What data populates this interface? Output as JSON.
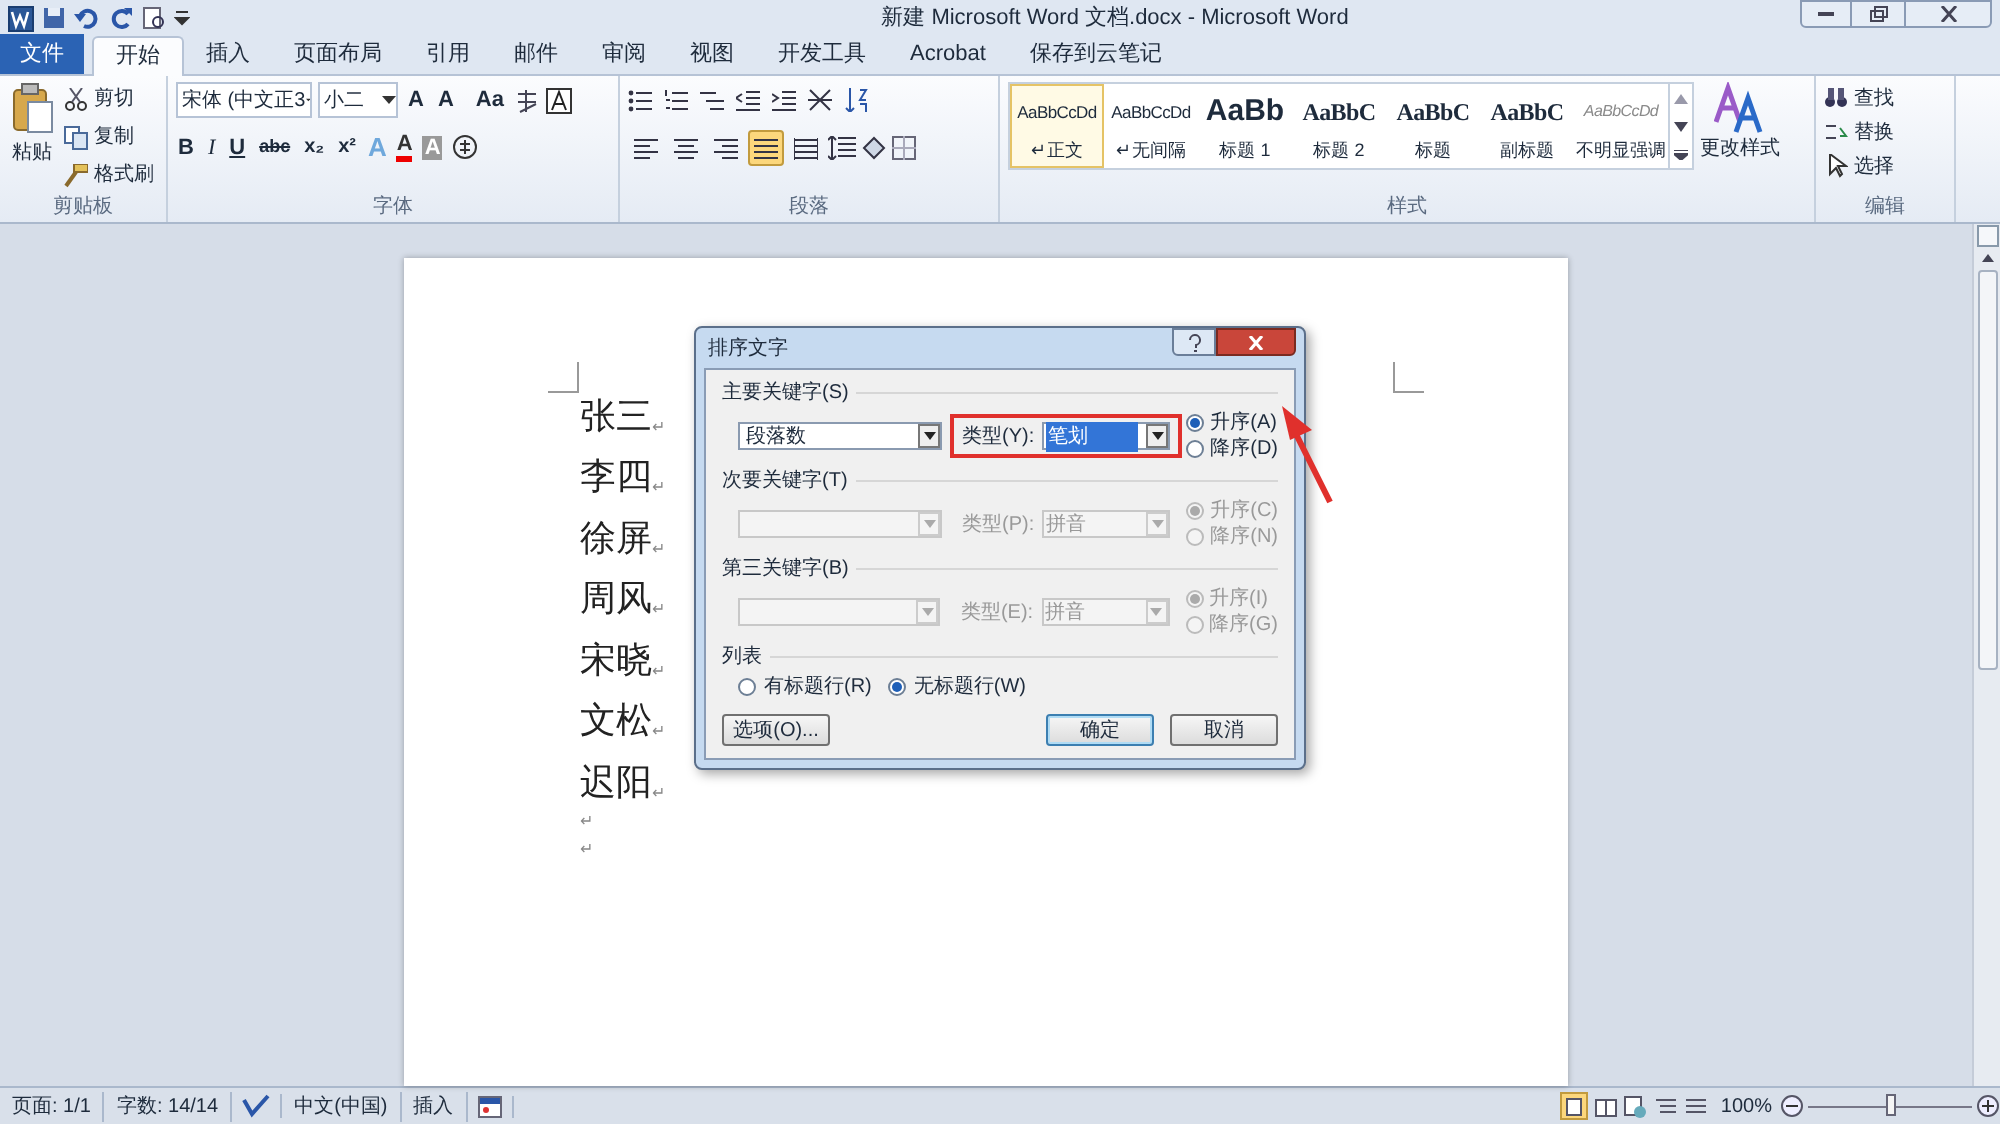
{
  "window": {
    "title": "新建 Microsoft Word 文档.docx - Microsoft Word"
  },
  "tabs": [
    {
      "label": "文件",
      "kind": "file",
      "selected": false
    },
    {
      "label": "开始",
      "kind": "tab",
      "selected": true
    },
    {
      "label": "插入",
      "kind": "tab",
      "selected": false
    },
    {
      "label": "页面布局",
      "kind": "tab",
      "selected": false
    },
    {
      "label": "引用",
      "kind": "tab",
      "selected": false
    },
    {
      "label": "邮件",
      "kind": "tab",
      "selected": false
    },
    {
      "label": "审阅",
      "kind": "tab",
      "selected": false
    },
    {
      "label": "视图",
      "kind": "tab",
      "selected": false
    },
    {
      "label": "开发工具",
      "kind": "tab",
      "selected": false
    },
    {
      "label": "Acrobat",
      "kind": "tab",
      "selected": false
    },
    {
      "label": "保存到云笔记",
      "kind": "tab",
      "selected": false
    }
  ],
  "clipboard": {
    "paste": "粘贴",
    "commands": [
      "剪切",
      "复制",
      "格式刷"
    ],
    "label": "剪贴板"
  },
  "font": {
    "name": "宋体 (中文正3",
    "size": "小二",
    "grow": "A",
    "shrink": "A",
    "case": "Aa",
    "formats": [
      "B",
      "I",
      "U",
      "abc",
      "x₂",
      "x²"
    ],
    "effects": [
      "A",
      "A",
      "A"
    ],
    "label": "字体"
  },
  "paragraph": {
    "alignments": [
      {
        "kind": "left",
        "selected": false
      },
      {
        "kind": "center",
        "selected": false
      },
      {
        "kind": "right",
        "selected": false
      },
      {
        "kind": "justify",
        "selected": true
      },
      {
        "kind": "distributed",
        "selected": false
      }
    ],
    "label": "段落"
  },
  "styles": {
    "items": [
      {
        "sample": "AaBbCcDd",
        "name": "↵正文",
        "kind": "body",
        "selected": true
      },
      {
        "sample": "AaBbCcDd",
        "name": "↵无间隔",
        "kind": "body",
        "selected": false
      },
      {
        "sample": "AaBb",
        "name": "标题 1",
        "kind": "title",
        "selected": false
      },
      {
        "sample": "AaBbC",
        "name": "标题 2",
        "kind": "heading",
        "selected": false
      },
      {
        "sample": "AaBbC",
        "name": "标题",
        "kind": "heading",
        "selected": false
      },
      {
        "sample": "AaBbC",
        "name": "副标题",
        "kind": "heading",
        "selected": false
      },
      {
        "sample": "AaBbCcDd",
        "name": "不明显强调",
        "kind": "subtle",
        "selected": false
      }
    ],
    "change": "更改样式",
    "label": "样式"
  },
  "editing": {
    "commands": [
      "查找",
      "替换",
      "选择"
    ],
    "label": "编辑"
  },
  "document": {
    "lines": [
      {
        "text": "张三",
        "mark": "↵"
      },
      {
        "text": "李四",
        "mark": "↵"
      },
      {
        "text": "徐屏",
        "mark": "↵"
      },
      {
        "text": "周风",
        "mark": "↵"
      },
      {
        "text": "宋晓",
        "mark": "↵"
      },
      {
        "text": "文松",
        "mark": "↵"
      },
      {
        "text": "迟阳",
        "mark": "↵"
      },
      {
        "mark": "↵"
      },
      {
        "mark": "↵"
      }
    ]
  },
  "dialog": {
    "title": "排序文字",
    "keys": [
      {
        "label": "主要关键字(S)",
        "field": "段落数",
        "type_label": "类型(Y):",
        "type_value": "笔划",
        "disabled": false,
        "highlighted": true,
        "order": [
          {
            "label": "升序(A)",
            "selected": true
          },
          {
            "label": "降序(D)",
            "selected": false
          }
        ]
      },
      {
        "label": "次要关键字(T)",
        "type_label": "类型(P):",
        "type_value": "拼音",
        "disabled": true,
        "highlighted": false,
        "order": [
          {
            "label": "升序(C)",
            "selected": true
          },
          {
            "label": "降序(N)",
            "selected": false
          }
        ]
      },
      {
        "label": "第三关键字(B)",
        "type_label": "类型(E):",
        "type_value": "拼音",
        "disabled": true,
        "highlighted": false,
        "order": [
          {
            "label": "升序(I)",
            "selected": true
          },
          {
            "label": "降序(G)",
            "selected": false
          }
        ]
      }
    ],
    "list": {
      "label": "列表",
      "options": [
        {
          "label": "有标题行(R)",
          "selected": false
        },
        {
          "label": "无标题行(W)",
          "selected": true
        }
      ]
    },
    "buttons": [
      {
        "label": "选项(O)...",
        "kind": "options"
      },
      {
        "label": "确定",
        "kind": "default"
      },
      {
        "label": "取消",
        "kind": "cancel"
      }
    ]
  },
  "status_bar": {
    "items": [
      "页面: 1/1",
      "字数: 14/14",
      "中文(中国)",
      "插入"
    ],
    "zoom": "100%",
    "zoom_slider": {
      "level": 0.5
    }
  }
}
